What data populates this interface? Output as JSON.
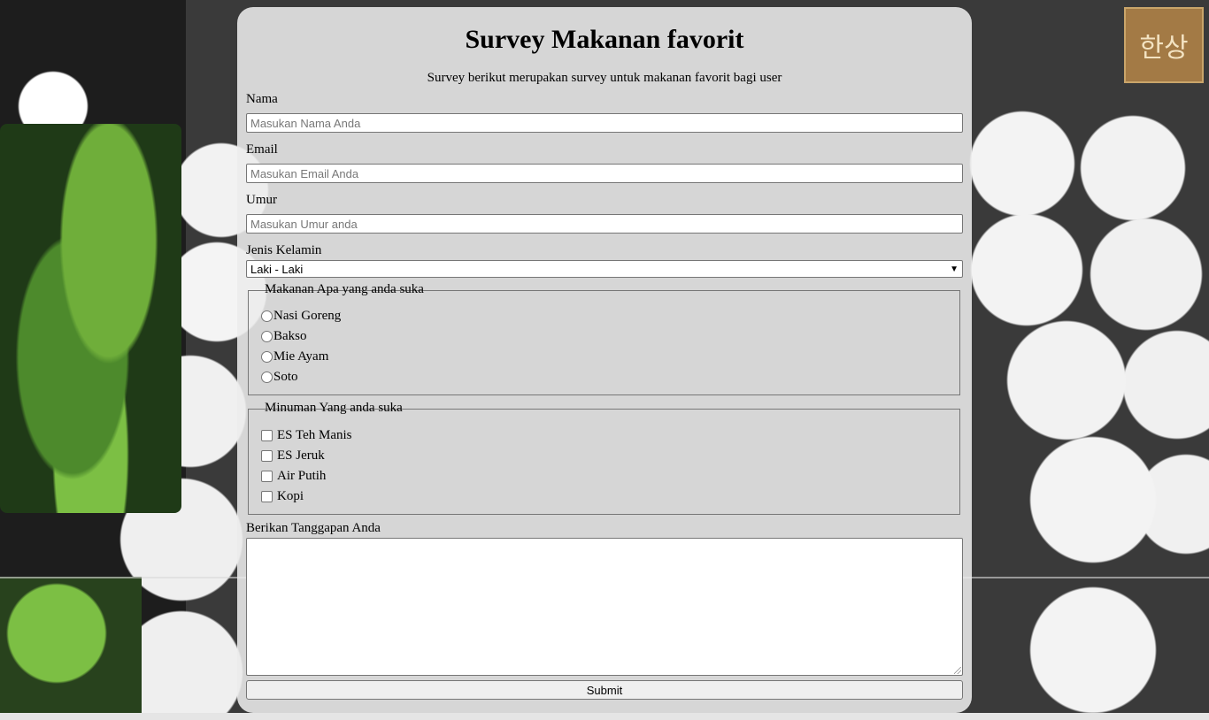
{
  "survey": {
    "title": "Survey Makanan favorit",
    "subtitle": "Survey berikut merupakan survey untuk makanan favorit bagi user"
  },
  "fields": {
    "nama_label": "Nama",
    "nama_placeholder": "Masukan Nama Anda",
    "email_label": "Email",
    "email_placeholder": "Masukan Email Anda",
    "umur_label": "Umur",
    "umur_placeholder": "Masukan Umur anda",
    "gender_label": "Jenis Kelamin",
    "gender_selected": "Laki - Laki"
  },
  "food": {
    "legend": "Makanan Apa yang anda suka",
    "options": [
      "Nasi Goreng",
      "Bakso",
      "Mie Ayam",
      "Soto"
    ]
  },
  "drink": {
    "legend": "Minuman Yang anda suka",
    "options": [
      "ES Teh Manis",
      "ES Jeruk",
      "Air Putih",
      "Kopi"
    ]
  },
  "feedback": {
    "label": "Berikan Tanggapan Anda"
  },
  "submit_label": "Submit",
  "logo_text": "한상",
  "colors": {
    "panel_bg": "#ececec",
    "logo_bg": "#a37a45"
  }
}
